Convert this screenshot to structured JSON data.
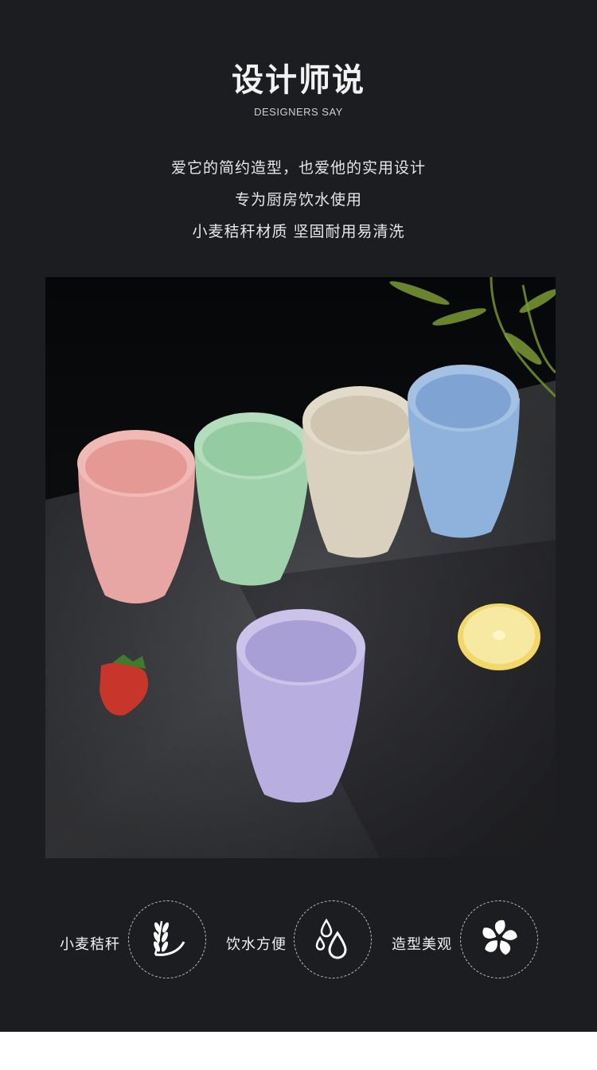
{
  "header": {
    "title": "设计师说",
    "subtitle": "DESIGNERS SAY"
  },
  "description": {
    "line1": "爱它的简约造型，也爱他的实用设计",
    "line2": "专为厨房饮水使用",
    "line3": "小麦秸秆材质 坚固耐用易清洗"
  },
  "features": [
    {
      "label": "小麦秸秆",
      "icon": "wheat-icon"
    },
    {
      "label": "饮水方便",
      "icon": "water-drops-icon"
    },
    {
      "label": "造型美观",
      "icon": "pinwheel-icon"
    }
  ],
  "photo": {
    "cup_colors": [
      "#e7a6a3",
      "#9fd2ab",
      "#d9d0bd",
      "#8fb2dc",
      "#b8aee0"
    ]
  }
}
